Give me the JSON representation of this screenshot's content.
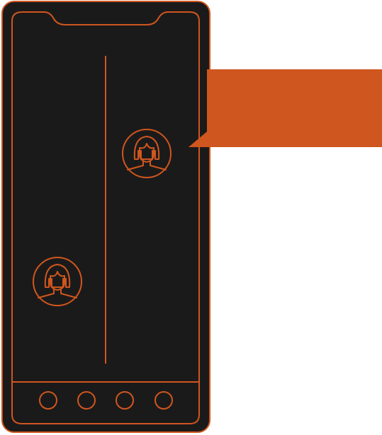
{
  "colors": {
    "accent": "#cf561e",
    "phone_body": "#1b1a1a",
    "background": "#ffffff"
  },
  "icons": {
    "avatar": "female-user-icon",
    "nav_buttons": [
      "nav-button-icon",
      "nav-button-icon",
      "nav-button-icon",
      "nav-button-icon"
    ]
  },
  "callout": {
    "text": ""
  }
}
